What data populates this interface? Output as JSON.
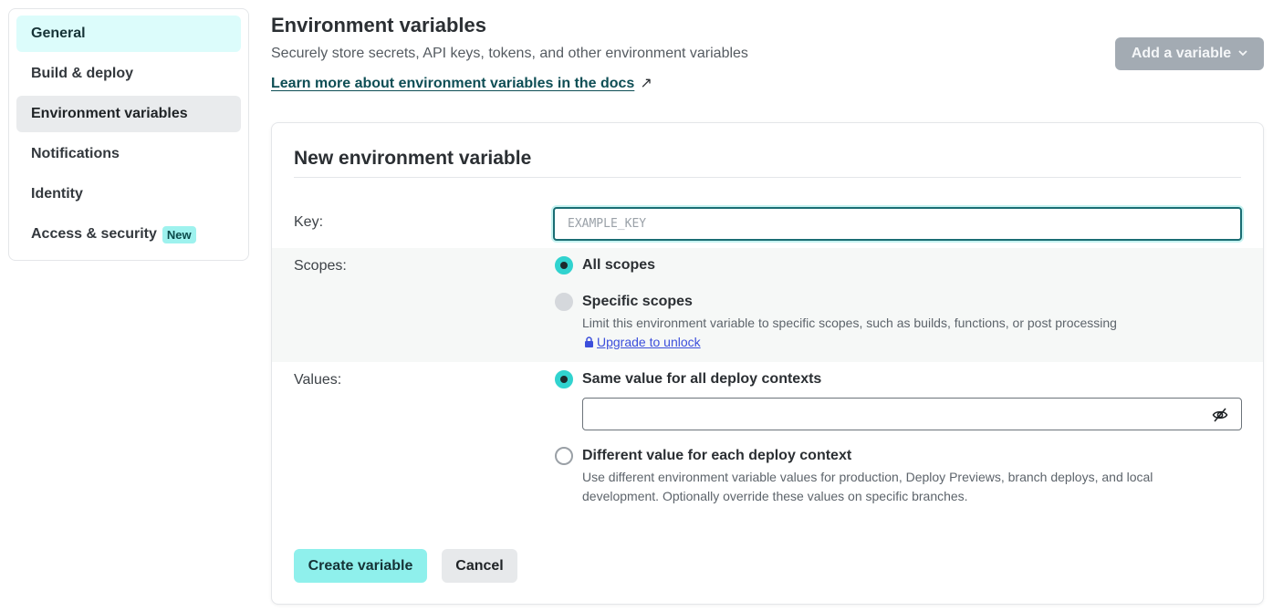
{
  "sidebar": {
    "items": [
      {
        "label": "General"
      },
      {
        "label": "Build & deploy"
      },
      {
        "label": "Environment variables"
      },
      {
        "label": "Notifications"
      },
      {
        "label": "Identity"
      },
      {
        "label": "Access & security",
        "badge": "New"
      }
    ]
  },
  "header": {
    "title": "Environment variables",
    "subtitle": "Securely store secrets, API keys, tokens, and other environment variables",
    "docs_link": "Learn more about environment variables in the docs",
    "docs_arrow": "↗",
    "add_button": "Add a variable",
    "add_button_chevron": "⌄"
  },
  "form": {
    "title": "New environment variable",
    "key_label": "Key:",
    "key_placeholder": "EXAMPLE_KEY",
    "scopes_label": "Scopes:",
    "scope_all": "All scopes",
    "scope_specific": "Specific scopes",
    "scope_specific_help": "Limit this environment variable to specific scopes, such as builds, functions, or post processing",
    "upgrade_link": "Upgrade to unlock",
    "values_label": "Values:",
    "value_same": "Same value for all deploy contexts",
    "value_different": "Different value for each deploy context",
    "value_different_help_1": "Use different environment variable values for production, Deploy Previews, branch deploys, and local",
    "value_different_help_2": "development. Optionally override these values on specific branches.",
    "create_button": "Create variable",
    "cancel_button": "Cancel"
  },
  "colors": {
    "accent": "#31d3cf",
    "link": "#3c4fdb",
    "create_bg": "#8ff0ec"
  }
}
